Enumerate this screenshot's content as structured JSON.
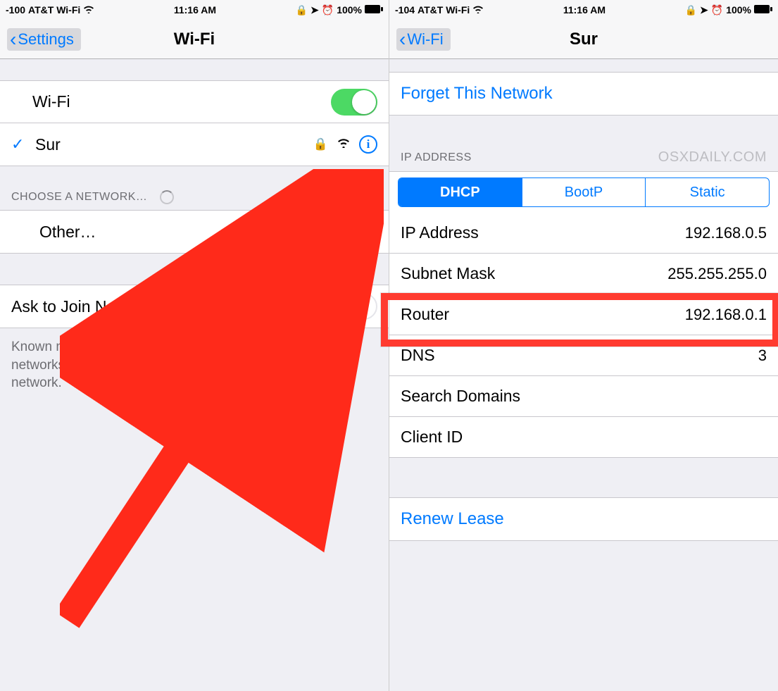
{
  "left": {
    "status": {
      "signal": "-100",
      "carrier": "AT&T Wi-Fi",
      "time": "11:16 AM",
      "battery": "100%"
    },
    "nav": {
      "back": "Settings",
      "title": "Wi-Fi"
    },
    "wifi_toggle_label": "Wi-Fi",
    "connected_network": "Sur",
    "choose_header": "CHOOSE A NETWORK…",
    "other_label": "Other…",
    "ask_join_label": "Ask to Join Networks",
    "footer": "Known networks will be joined automatically. If no known networks are available, you will have to manually select a network."
  },
  "right": {
    "status": {
      "signal": "-104",
      "carrier": "AT&T Wi-Fi",
      "time": "11:16 AM",
      "battery": "100%"
    },
    "nav": {
      "back": "Wi-Fi",
      "title": "Sur"
    },
    "forget_label": "Forget This Network",
    "ip_header": "IP ADDRESS",
    "watermark": "osxdaily.com",
    "segments": {
      "dhcp": "DHCP",
      "bootp": "BootP",
      "static": "Static"
    },
    "rows": {
      "ip_label": "IP Address",
      "ip_value": "192.168.0.5",
      "subnet_label": "Subnet Mask",
      "subnet_value": "255.255.255.0",
      "router_label": "Router",
      "router_value": "192.168.0.1",
      "dns_label": "DNS",
      "dns_value": "3",
      "search_label": "Search Domains",
      "search_value": "",
      "client_label": "Client ID",
      "client_value": ""
    },
    "renew_label": "Renew Lease"
  }
}
